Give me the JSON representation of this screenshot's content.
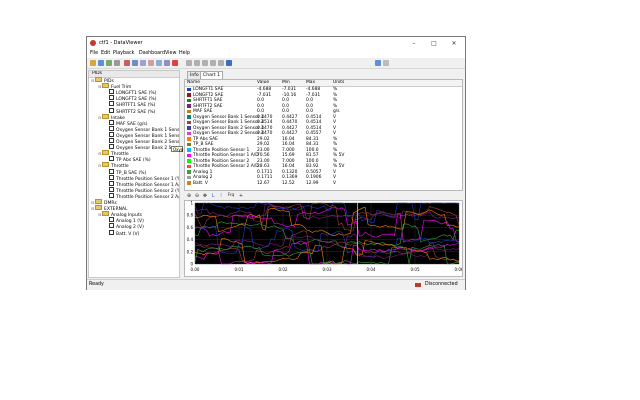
{
  "window": {
    "title": "ctf1 - DataViewer"
  },
  "menu": [
    "File",
    "Edit",
    "Playback",
    "Dashboard",
    "View",
    "Help"
  ],
  "toolbar": {
    "dashboard_select": "(new dashboard)"
  },
  "left_panel": {
    "title": "PIDs",
    "tree": [
      {
        "label": "PIDs",
        "level": 0,
        "type": "folder"
      },
      {
        "label": "Fuel Trim",
        "level": 1,
        "type": "folder"
      },
      {
        "label": "LONGFT1 SAE (%)",
        "level": 2,
        "type": "check"
      },
      {
        "label": "LONGFT2 SAE (%)",
        "level": 2,
        "type": "check"
      },
      {
        "label": "SHRTFT1 SAE (%)",
        "level": 2,
        "type": "check"
      },
      {
        "label": "SHRTFT2 SAE (%)",
        "level": 2,
        "type": "check"
      },
      {
        "label": "Intake",
        "level": 1,
        "type": "folder"
      },
      {
        "label": "MAF SAE (g/s)",
        "level": 2,
        "type": "check"
      },
      {
        "label": "Oxygen Sensor Bank 1 Sensor 1 (V)",
        "level": 2,
        "type": "check"
      },
      {
        "label": "Oxygen Sensor Bank 1 Sensor 2 (V)",
        "level": 2,
        "type": "check"
      },
      {
        "label": "Oxygen Sensor Bank 2 Sensor 1 (V)",
        "level": 2,
        "type": "check"
      },
      {
        "label": "Oxygen Sensor Bank 2 Sensor 2 (V)",
        "level": 2,
        "type": "check"
      },
      {
        "label": "Throttle",
        "level": 1,
        "type": "folder"
      },
      {
        "label": "TP Abs SAE (%)",
        "level": 2,
        "type": "check"
      },
      {
        "label": "Throttle",
        "level": 1,
        "type": "folder"
      },
      {
        "label": "TP_B SAE (%)",
        "level": 2,
        "type": "check"
      },
      {
        "label": "Throttle Position Sensor 1 (%)",
        "level": 2,
        "type": "check"
      },
      {
        "label": "Throttle Position Sensor 1 A/D (% 5",
        "level": 2,
        "type": "check"
      },
      {
        "label": "Throttle Position Sensor 2 (%)",
        "level": 2,
        "type": "check"
      },
      {
        "label": "Throttle Position Sensor 2 A/D (% 5",
        "level": 2,
        "type": "check"
      },
      {
        "label": "DMRs",
        "level": 0,
        "type": "folder"
      },
      {
        "label": "EXTERNAL",
        "level": 0,
        "type": "folder"
      },
      {
        "label": "Analog Inputs",
        "level": 1,
        "type": "folder"
      },
      {
        "label": "Analog 1 (V)",
        "level": 2,
        "type": "check"
      },
      {
        "label": "Analog 2 (V)",
        "level": 2,
        "type": "check"
      },
      {
        "label": "Batt. V (V)",
        "level": 2,
        "type": "check"
      }
    ],
    "tooltip": "Oxyg"
  },
  "tabs": [
    "Info",
    "Chart 1"
  ],
  "table": {
    "headers": [
      "Name",
      "Value",
      "Min",
      "Max",
      "Units"
    ],
    "rows": [
      {
        "name": "LONGFT1 SAE",
        "value": "-4.688",
        "min": "-7.031",
        "max": "-4.688",
        "units": "%",
        "color": "#1f3fbf"
      },
      {
        "name": "LONGFT2 SAE",
        "value": "-7.031",
        "min": "-10.16",
        "max": "-7.031",
        "units": "%",
        "color": "#8b1a1a"
      },
      {
        "name": "SHRTFT1 SAE",
        "value": "0.0",
        "min": "0.0",
        "max": "0.0",
        "units": "%",
        "color": "#1f7f1f"
      },
      {
        "name": "SHRTFT2 SAE",
        "value": "0.0",
        "min": "0.0",
        "max": "0.0",
        "units": "%",
        "color": "#7f1f7f"
      },
      {
        "name": "MAF SAE",
        "value": "0.0",
        "min": "0.0",
        "max": "0.0",
        "units": "g/s",
        "color": "#b8860b"
      },
      {
        "name": "Oxygen Sensor Bank 1 Sensor 1",
        "value": "0.4470",
        "min": "0.4427",
        "max": "0.4514",
        "units": "V",
        "color": "#0f7f7f"
      },
      {
        "name": "Oxygen Sensor Bank 1 Sensor 2",
        "value": "0.4514",
        "min": "0.4470",
        "max": "0.4514",
        "units": "V",
        "color": "#9f3f3f"
      },
      {
        "name": "Oxygen Sensor Bank 2 Sensor 1",
        "value": "0.4470",
        "min": "0.4427",
        "max": "0.4514",
        "units": "V",
        "color": "#3f3f9f"
      },
      {
        "name": "Oxygen Sensor Bank 2 Sensor 2",
        "value": "0.4470",
        "min": "0.4427",
        "max": "0.4557",
        "units": "V",
        "color": "#df3fdf"
      },
      {
        "name": "TP Abs SAE",
        "value": "29.02",
        "min": "16.04",
        "max": "84.31",
        "units": "%",
        "color": "#ff7f00"
      },
      {
        "name": "TP_B SAE",
        "value": "29.02",
        "min": "16.04",
        "max": "84.31",
        "units": "%",
        "color": "#7f7f00"
      },
      {
        "name": "Throttle Position Sensor 1",
        "value": "23.00",
        "min": "7.000",
        "max": "100.0",
        "units": "%",
        "color": "#00bfff"
      },
      {
        "name": "Throttle Position Sensor 1 A/D",
        "value": "70.56",
        "min": "15.69",
        "max": "81.57",
        "units": "% 5V",
        "color": "#ff00ff"
      },
      {
        "name": "Throttle Position Sensor 2",
        "value": "23.00",
        "min": "7.000",
        "max": "100.0",
        "units": "%",
        "color": "#00ff00"
      },
      {
        "name": "Throttle Position Sensor 2 A/D",
        "value": "28.63",
        "min": "16.04",
        "max": "83.92",
        "units": "% 5V",
        "color": "#ff4040"
      },
      {
        "name": "Analog 1",
        "value": "0.1711",
        "min": "0.1320",
        "max": "0.5057",
        "units": "V",
        "color": "#3f9f3f"
      },
      {
        "name": "Analog 2",
        "value": "0.1711",
        "min": "0.1369",
        "max": "0.1906",
        "units": "V",
        "color": "#9f9f9f"
      },
      {
        "name": "Batt. V",
        "value": "12.67",
        "min": "12.52",
        "max": "12.99",
        "units": "V",
        "color": "#cf7f1f"
      }
    ]
  },
  "chart_toolbar": [
    "zoom-in-icon",
    "zoom-out-icon",
    "pan-icon",
    "lock-icon",
    "cursor-icon",
    "freq-icon",
    "add-icon"
  ],
  "chart_toolbar_labels": {
    "lock": "L",
    "freq": "Frq"
  },
  "chart_data": {
    "type": "line",
    "x_ticks": [
      "0.00",
      "0:01",
      "0:02",
      "0:03",
      "0:04",
      "0:05",
      "0:06"
    ],
    "y_ticks": [
      "1",
      "0.8",
      "0.6",
      "0.4",
      "0.2",
      "0"
    ],
    "xlim": [
      0,
      6
    ],
    "ylim": [
      0,
      1
    ],
    "grid": true,
    "background": "#000000"
  },
  "status": {
    "left": "Ready",
    "right": "Disconnected"
  }
}
